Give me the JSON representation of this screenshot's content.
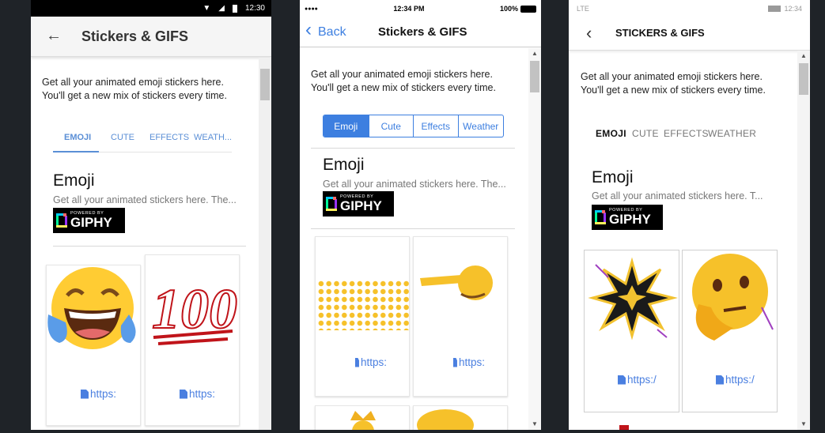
{
  "android": {
    "status_time": "12:30",
    "title": "Stickers & GIFS",
    "intro": "Get all your animated emoji stickers here. You'll get a new mix of stickers every time.",
    "tabs": [
      "EMOJI",
      "CUTE",
      "EFFECTS",
      "WEATH..."
    ],
    "heading": "Emoji",
    "subtext": "Get all your animated stickers here. The...",
    "link_text": "https:"
  },
  "ios": {
    "carrier_dots": "●●●●",
    "status_time": "12:34 PM",
    "battery": "100%",
    "back_label": "Back",
    "title": "Stickers & GIFS",
    "intro": "Get all your animated emoji stickers here. You'll get a new mix of stickers every time.",
    "tabs": [
      "Emoji",
      "Cute",
      "Effects",
      "Weather"
    ],
    "heading": "Emoji",
    "subtext": "Get all your animated stickers here. The...",
    "link_text": "https:"
  },
  "winphone": {
    "network": "LTE",
    "status_time": "12:34",
    "title": "STICKERS & GIFS",
    "intro": "Get all your animated emoji stickers here. You'll get a new mix of stickers every time.",
    "tabs": [
      "EMOJI",
      "CUTE",
      "EFFECTS",
      "WEATHER"
    ],
    "heading": "Emoji",
    "subtext": "Get all your animated stickers here. T...",
    "link_text": "https:/"
  },
  "giphy": {
    "powered_by": "POWERED BY",
    "brand": "GIPHY"
  },
  "stickers": {
    "hundred": "100"
  },
  "colors": {
    "accent_android": "#5b8fd6",
    "accent_ios": "#3d7fe0",
    "link": "#4a7fe0",
    "background": "#1f2328"
  }
}
